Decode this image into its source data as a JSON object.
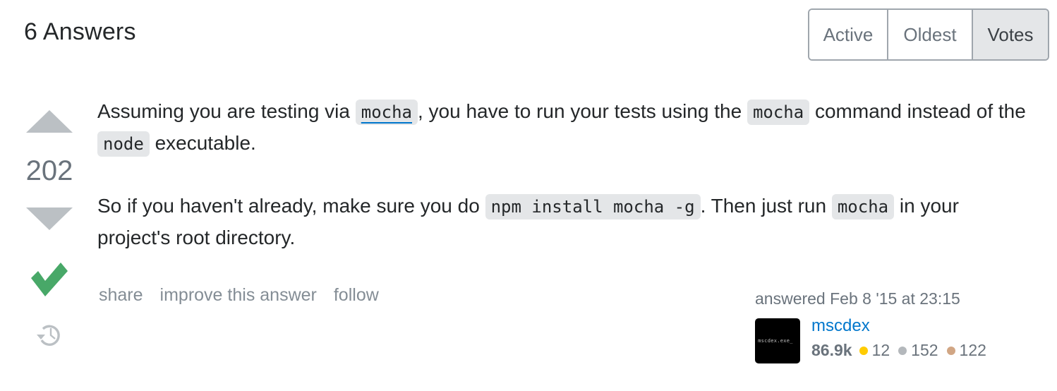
{
  "header": {
    "answers_title": "6 Answers",
    "sort_tabs": [
      {
        "label": "Active",
        "selected": false
      },
      {
        "label": "Oldest",
        "selected": false
      },
      {
        "label": "Votes",
        "selected": true
      }
    ]
  },
  "answer": {
    "vote_count": "202",
    "accepted": true,
    "icons": {
      "upvote": "triangle-up-icon",
      "downvote": "triangle-down-icon",
      "accepted": "checkmark-icon",
      "history": "history-icon"
    },
    "colors": {
      "accepted_green": "#48a868",
      "vote_arrow": "#bbc0c4",
      "link_blue": "#0077cc",
      "code_bg": "#e4e6e8"
    },
    "paragraph1": {
      "t1": "Assuming you are testing via ",
      "code1": "mocha",
      "t2": ", you have to run your tests using the ",
      "code2": "mocha",
      "t3": " command instead of the ",
      "code3": "node",
      "t4": " executable."
    },
    "paragraph2": {
      "t1": "So if you haven't already, make sure you do ",
      "code1": "npm install mocha -g",
      "t2": ". Then just run ",
      "code2": "mocha",
      "t3": " in your project's root directory."
    },
    "menu": {
      "share": "share",
      "improve": "improve this answer",
      "follow": "follow"
    },
    "user": {
      "action_time": "answered Feb 8 '15 at 23:15",
      "avatar_text": "mscdex.exe_",
      "name": "mscdex",
      "reputation": "86.9k",
      "badges": [
        {
          "type": "gold",
          "count": "12",
          "color": "#ffcc01"
        },
        {
          "type": "silver",
          "count": "152",
          "color": "#b4b8bc"
        },
        {
          "type": "bronze",
          "count": "122",
          "color": "#d1a684"
        }
      ]
    }
  }
}
